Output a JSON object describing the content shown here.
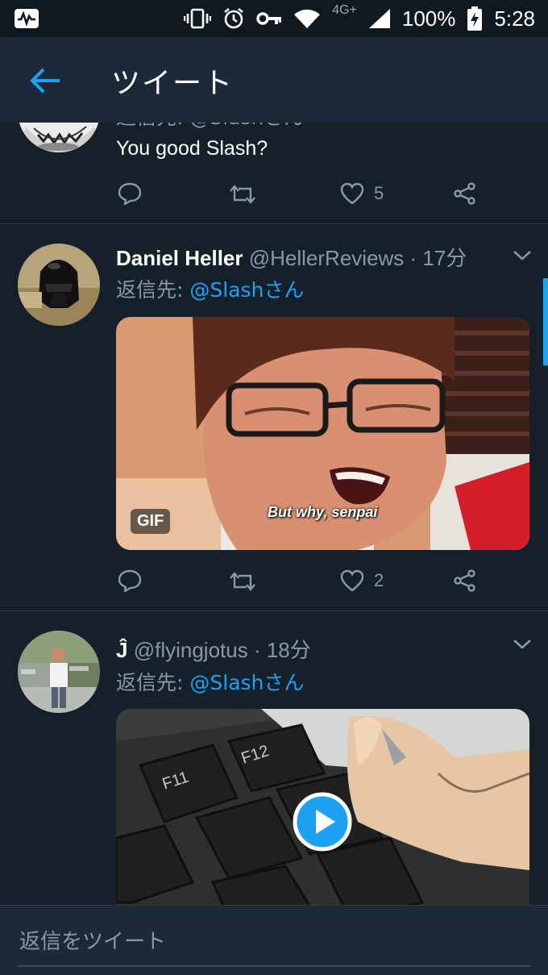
{
  "status_bar": {
    "network": "4G+",
    "battery": "100%",
    "time": "5:28"
  },
  "app_bar": {
    "title": "ツイート",
    "back_icon": "back-arrow-icon"
  },
  "tweets": [
    {
      "reply_to_partial": "返信先: @Slashさん",
      "text": "You good Slash?",
      "likes": "5"
    },
    {
      "name": "Daniel Heller",
      "handle": "@HellerReviews",
      "time": "· 17分",
      "reply_prefix": "返信先: ",
      "reply_mention": "@Slashさん",
      "gif_badge": "GIF",
      "gif_caption": "But why, senpai",
      "likes": "2"
    },
    {
      "name_glyph": "Ĵ",
      "handle": "@flyingjotus",
      "time": "· 18分",
      "reply_prefix": "返信先: ",
      "reply_mention": "@Slashさん",
      "key_labels": [
        "F11",
        "F12"
      ]
    }
  ],
  "reply_bar": {
    "placeholder": "返信をツイート"
  },
  "colors": {
    "background": "#15202b",
    "bar": "#1c2938",
    "accent": "#1da1f2",
    "muted": "#8899a6"
  }
}
